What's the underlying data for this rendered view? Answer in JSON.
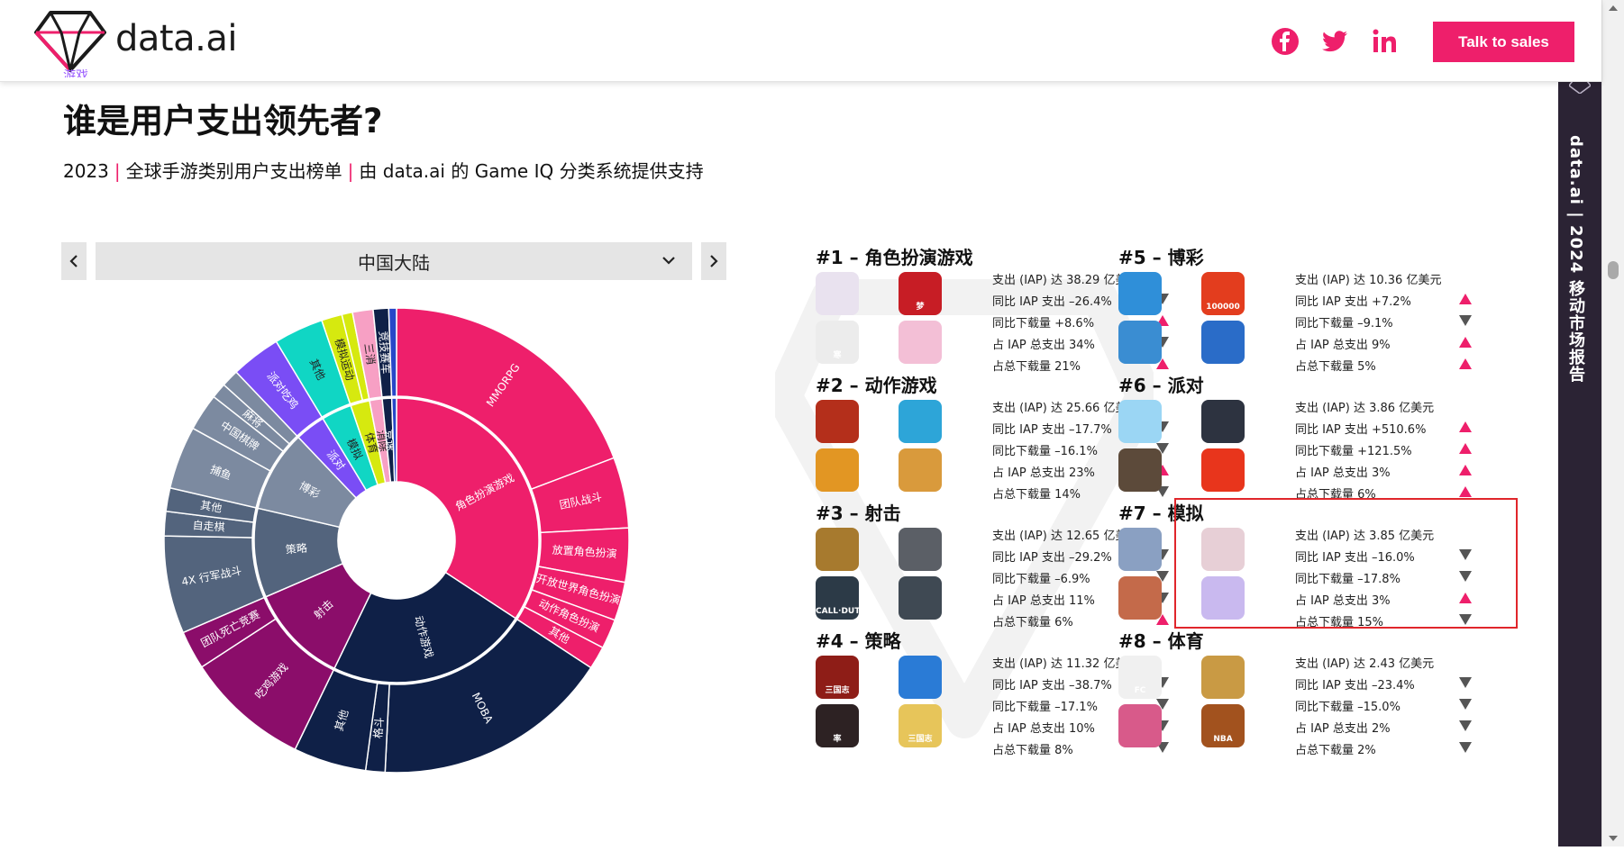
{
  "header": {
    "brand": "data.ai",
    "talk_label": "Talk to sales",
    "social_icons": [
      "facebook-icon",
      "twitter-icon",
      "linkedin-icon"
    ]
  },
  "side_banner": {
    "text": "data.ai | 2024 移动市场报告"
  },
  "page": {
    "section_label": "游戏",
    "title": "谁是用户支出领先者?",
    "subtitle_parts": [
      "2023",
      "全球手游类别用户支出榜单",
      "由 data.ai 的 Game IQ 分类系统提供支持"
    ],
    "separator": "|"
  },
  "region": {
    "selected": "中国大陆"
  },
  "colors": {
    "accent": "#ee1f6b",
    "navy": "#0f2047",
    "slate": "#53647d",
    "magenta": "#8b0d6a",
    "teal": "#10d6c4",
    "purple": "#7a4df5",
    "lime": "#d6e90f",
    "pink": "#f7a0c4"
  },
  "sunburst": {
    "inner": [
      {
        "label": "角色扮演游戏",
        "value": 38.29,
        "color": "#ee1f6b"
      },
      {
        "label": "动作游戏",
        "value": 25.66,
        "color": "#0f2047"
      },
      {
        "label": "射击",
        "value": 12.65,
        "color": "#8b0d6a"
      },
      {
        "label": "策略",
        "value": 11.32,
        "color": "#53647d"
      },
      {
        "label": "博彩",
        "value": 10.36,
        "color": "#7c8aa0"
      },
      {
        "label": "派对",
        "value": 3.86,
        "color": "#7a4df5"
      },
      {
        "label": "模拟",
        "value": 3.85,
        "color": "#10d6c4"
      },
      {
        "label": "体育",
        "value": 2.43,
        "color": "#d6e90f"
      },
      {
        "label": "消除",
        "value": 1.6,
        "color": "#f7a0c4"
      },
      {
        "label": "竞速",
        "value": 1.2,
        "color": "#0f2047"
      },
      {
        "label": "",
        "value": 0.6,
        "color": "#2747c8"
      }
    ],
    "outer": [
      {
        "label": "MMORPG",
        "value": 21.5,
        "color": "#ee1f6b"
      },
      {
        "label": "团队战斗",
        "value": 5.5,
        "color": "#ee1f6b"
      },
      {
        "label": "放置角色扮演",
        "value": 4.2,
        "color": "#ee1f6b"
      },
      {
        "label": "开放世界角色扮演",
        "value": 3.0,
        "color": "#ee1f6b"
      },
      {
        "label": "动作角色扮演",
        "value": 2.3,
        "color": "#ee1f6b"
      },
      {
        "label": "其他",
        "value": 1.79,
        "color": "#ee1f6b"
      },
      {
        "label": "MOBA",
        "value": 18.5,
        "color": "#0f2047"
      },
      {
        "label": "格斗",
        "value": 1.5,
        "color": "#0f2047"
      },
      {
        "label": "其他",
        "value": 5.66,
        "color": "#0f2047"
      },
      {
        "label": "吃鸡游戏",
        "value": 9.65,
        "color": "#8b0d6a"
      },
      {
        "label": "团队死亡竞赛",
        "value": 3.0,
        "color": "#8b0d6a"
      },
      {
        "label": "4X 行军战斗",
        "value": 7.6,
        "color": "#53647d"
      },
      {
        "label": "自走棋",
        "value": 1.9,
        "color": "#53647d"
      },
      {
        "label": "其他",
        "value": 1.82,
        "color": "#53647d"
      },
      {
        "label": "捕鱼",
        "value": 4.9,
        "color": "#7c8aa0"
      },
      {
        "label": "中国棋牌",
        "value": 2.9,
        "color": "#7c8aa0"
      },
      {
        "label": "麻将",
        "value": 1.2,
        "color": "#7c8aa0"
      },
      {
        "label": "",
        "value": 1.36,
        "color": "#7c8aa0"
      },
      {
        "label": "派对吃鸡",
        "value": 3.86,
        "color": "#7a4df5"
      },
      {
        "label": "其他",
        "value": 3.85,
        "color": "#10d6c4"
      },
      {
        "label": "模拟运动",
        "value": 1.6,
        "color": "#d6e90f"
      },
      {
        "label": "",
        "value": 0.83,
        "color": "#d6e90f"
      },
      {
        "label": "三消",
        "value": 1.6,
        "color": "#f7a0c4"
      },
      {
        "label": "竞技赛车",
        "value": 1.2,
        "color": "#0f2047"
      },
      {
        "label": "",
        "value": 0.6,
        "color": "#2747c8"
      }
    ]
  },
  "categories": [
    {
      "rank_title": "#1 – 角色扮演游戏",
      "icons": [
        {
          "name": "genshin-app-icon",
          "bg": "#e9e2ef",
          "text": ""
        },
        {
          "name": "fantasy-westward-app-icon",
          "bg": "#c71d25",
          "text": "梦"
        },
        {
          "name": "ink-style-app-icon",
          "bg": "#ececec",
          "text": "寒"
        },
        {
          "name": "star-rail-app-icon",
          "bg": "#f3bfd6",
          "text": ""
        }
      ],
      "stats": [
        {
          "text": "支出 (IAP) 达 38.29 亿美元",
          "trend": "none"
        },
        {
          "text": "同比 IAP 支出 –26.4%",
          "trend": "down"
        },
        {
          "text": "同比下载量 +8.6%",
          "trend": "up"
        },
        {
          "text": "占 IAP 总支出 34%",
          "trend": "down"
        },
        {
          "text": "占总下载量 21%",
          "trend": "up"
        }
      ]
    },
    {
      "rank_title": "#2 – 动作游戏",
      "icons": [
        {
          "name": "honor-of-kings-app-icon",
          "bg": "#b42f1b",
          "text": ""
        },
        {
          "name": "lol-wild-rift-app-icon",
          "bg": "#2da5d8",
          "text": ""
        },
        {
          "name": "naruto-app-icon",
          "bg": "#e29623",
          "text": ""
        },
        {
          "name": "brawl-app-icon",
          "bg": "#d99a3c",
          "text": ""
        }
      ],
      "stats": [
        {
          "text": "支出 (IAP) 达 25.66 亿美元",
          "trend": "none"
        },
        {
          "text": "同比 IAP 支出 –17.7%",
          "trend": "down"
        },
        {
          "text": "同比下载量 –16.1%",
          "trend": "down"
        },
        {
          "text": "占 IAP 总支出 23%",
          "trend": "up"
        },
        {
          "text": "占总下载量 14%",
          "trend": "down"
        }
      ]
    },
    {
      "rank_title": "#3 – 射击",
      "icons": [
        {
          "name": "peacekeeper-elite-app-icon",
          "bg": "#a77a2e",
          "text": ""
        },
        {
          "name": "crossfire-app-icon",
          "bg": "#5b5f66",
          "text": ""
        },
        {
          "name": "call-of-duty-app-icon",
          "bg": "#2c3a47",
          "text": "CALL·DUTY"
        },
        {
          "name": "arena-breakout-app-icon",
          "bg": "#3f4953",
          "text": ""
        }
      ],
      "stats": [
        {
          "text": "支出 (IAP) 达 12.65 亿美元",
          "trend": "none"
        },
        {
          "text": "同比 IAP 支出 –29.2%",
          "trend": "down"
        },
        {
          "text": "同比下载量 –6.9%",
          "trend": "down"
        },
        {
          "text": "占 IAP 总支出 11%",
          "trend": "down"
        },
        {
          "text": "占总下载量 6%",
          "trend": "up"
        }
      ]
    },
    {
      "rank_title": "#4 – 策略",
      "icons": [
        {
          "name": "three-kingdoms-app-icon",
          "bg": "#8e1d17",
          "text": "三国志"
        },
        {
          "name": "penguin-app-icon",
          "bg": "#2a7bd6",
          "text": ""
        },
        {
          "name": "shuai-app-icon",
          "bg": "#2d2223",
          "text": "率"
        },
        {
          "name": "three-kingdoms-chess-app-icon",
          "bg": "#e7c55a",
          "text": "三国志"
        }
      ],
      "stats": [
        {
          "text": "支出 (IAP) 达 11.32 亿美元",
          "trend": "none"
        },
        {
          "text": "同比 IAP 支出 –38.7%",
          "trend": "down"
        },
        {
          "text": "同比下载量 –17.1%",
          "trend": "down"
        },
        {
          "text": "占 IAP 总支出 10%",
          "trend": "down"
        },
        {
          "text": "占总下载量 8%",
          "trend": "down"
        }
      ]
    },
    {
      "rank_title": "#5 – 博彩",
      "icons": [
        {
          "name": "fish-shark-app-icon",
          "bg": "#2f8fd9",
          "text": ""
        },
        {
          "name": "fish-100000-app-icon",
          "bg": "#e33d1e",
          "text": "100000"
        },
        {
          "name": "god-of-wealth-app-icon",
          "bg": "#3a8dd2",
          "text": ""
        },
        {
          "name": "shark-bite-app-icon",
          "bg": "#2a6cc8",
          "text": ""
        }
      ],
      "stats": [
        {
          "text": "支出 (IAP) 达 10.36 亿美元",
          "trend": "none"
        },
        {
          "text": "同比 IAP 支出 +7.2%",
          "trend": "up"
        },
        {
          "text": "同比下载量 –9.1%",
          "trend": "down"
        },
        {
          "text": "占 IAP 总支出 9%",
          "trend": "up"
        },
        {
          "text": "占总下载量 5%",
          "trend": "up"
        }
      ]
    },
    {
      "rank_title": "#6 – 派对",
      "icons": [
        {
          "name": "eggy-party-app-icon",
          "bg": "#9bd6f4",
          "text": ""
        },
        {
          "name": "goose-duck-app-icon",
          "bg": "#2d3340",
          "text": ""
        },
        {
          "name": "werewolf-app-icon",
          "bg": "#5c4a3a",
          "text": ""
        },
        {
          "name": "among-us-app-icon",
          "bg": "#e8351c",
          "text": ""
        }
      ],
      "stats": [
        {
          "text": "支出 (IAP) 达 3.86 亿美元",
          "trend": "none"
        },
        {
          "text": "同比 IAP 支出 +510.6%",
          "trend": "up"
        },
        {
          "text": "同比下载量 +121.5%",
          "trend": "up"
        },
        {
          "text": "占 IAP 总支出 3%",
          "trend": "up"
        },
        {
          "text": "占总下载量 6%",
          "trend": "up"
        }
      ]
    },
    {
      "rank_title": "#7 – 模拟",
      "icons": [
        {
          "name": "love-and-deepspace-app-icon",
          "bg": "#8aa0c2",
          "text": ""
        },
        {
          "name": "infinity-nikki-app-icon",
          "bg": "#e7cfd6",
          "text": ""
        },
        {
          "name": "romance-sunset-app-icon",
          "bg": "#c46a4a",
          "text": ""
        },
        {
          "name": "anime-girl-app-icon",
          "bg": "#c9b9ef",
          "text": ""
        }
      ],
      "stats": [
        {
          "text": "支出 (IAP) 达 3.85 亿美元",
          "trend": "none"
        },
        {
          "text": "同比 IAP 支出 –16.0%",
          "trend": "down"
        },
        {
          "text": "同比下载量 –17.8%",
          "trend": "down"
        },
        {
          "text": "占 IAP 总支出 3%",
          "trend": "up"
        },
        {
          "text": "占总下载量 15%",
          "trend": "down"
        }
      ]
    },
    {
      "rank_title": "#8 – 体育",
      "icons": [
        {
          "name": "ea-fc-app-icon",
          "bg": "#f0f0f0",
          "text": "FC"
        },
        {
          "name": "nba-team-app-icon",
          "bg": "#c99a44",
          "text": ""
        },
        {
          "name": "dance-app-icon",
          "bg": "#d85a8a",
          "text": ""
        },
        {
          "name": "nba-app-icon",
          "bg": "#a2521e",
          "text": "NBA"
        }
      ],
      "stats": [
        {
          "text": "支出 (IAP) 达 2.43 亿美元",
          "trend": "none"
        },
        {
          "text": "同比 IAP 支出 –23.4%",
          "trend": "down"
        },
        {
          "text": "同比下载量 –15.0%",
          "trend": "down"
        },
        {
          "text": "占 IAP 总支出 2%",
          "trend": "down"
        },
        {
          "text": "占总下载量 2%",
          "trend": "down"
        }
      ]
    }
  ]
}
